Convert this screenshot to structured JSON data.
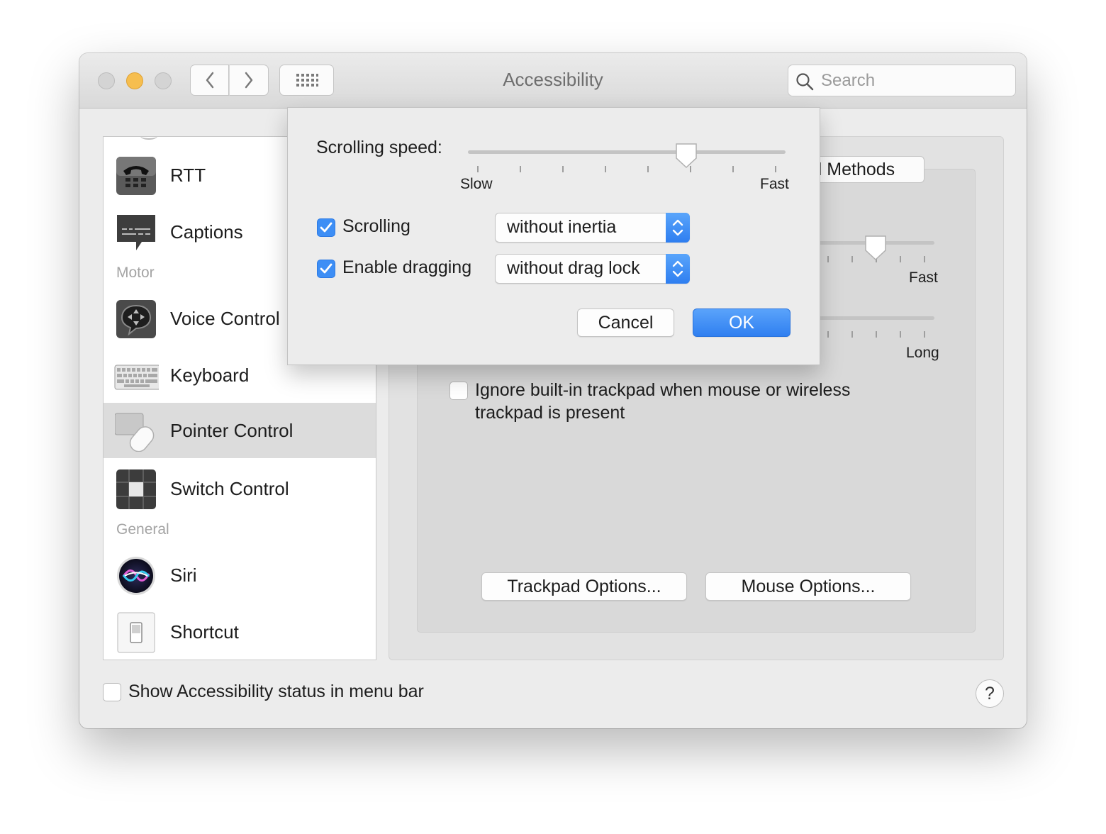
{
  "window": {
    "title": "Accessibility"
  },
  "search": {
    "placeholder": "Search"
  },
  "sidebar": {
    "items": [
      {
        "label": "RTT",
        "icon": "telephone-icon"
      },
      {
        "label": "Captions",
        "icon": "captions-icon"
      },
      {
        "label": "Voice Control",
        "icon": "voice-control-icon"
      },
      {
        "label": "Keyboard",
        "icon": "keyboard-icon"
      },
      {
        "label": "Pointer Control",
        "icon": "pointer-control-icon",
        "selected": true
      },
      {
        "label": "Switch Control",
        "icon": "switch-control-icon"
      },
      {
        "label": "Siri",
        "icon": "siri-icon"
      },
      {
        "label": "Shortcut",
        "icon": "shortcut-icon"
      }
    ],
    "sections": {
      "motor": "Motor",
      "general": "General"
    }
  },
  "content": {
    "segment_label": "l Methods",
    "slider1_right": "Fast",
    "slider2_right": "Long",
    "ignore_checkbox_label_line1": "Ignore built-in trackpad when mouse or wireless",
    "ignore_checkbox_label_line2": "trackpad is present",
    "ignore_checked": false,
    "trackpad_options": "Trackpad Options...",
    "mouse_options": "Mouse Options..."
  },
  "footer": {
    "status_label": "Show Accessibility status in menu bar",
    "status_checked": false,
    "help": "?"
  },
  "sheet": {
    "scrolling_speed_label": "Scrolling speed:",
    "speed_min_label": "Slow",
    "speed_max_label": "Fast",
    "speed_value_fraction": 0.7,
    "scrolling_label": "Scrolling",
    "scrolling_checked": true,
    "scrolling_option": "without inertia",
    "dragging_label": "Enable dragging",
    "dragging_checked": true,
    "dragging_option": "without drag lock",
    "cancel": "Cancel",
    "ok": "OK"
  },
  "colors": {
    "accent": "#3d8ef5",
    "traffic_yellow": "#f6be4f"
  }
}
